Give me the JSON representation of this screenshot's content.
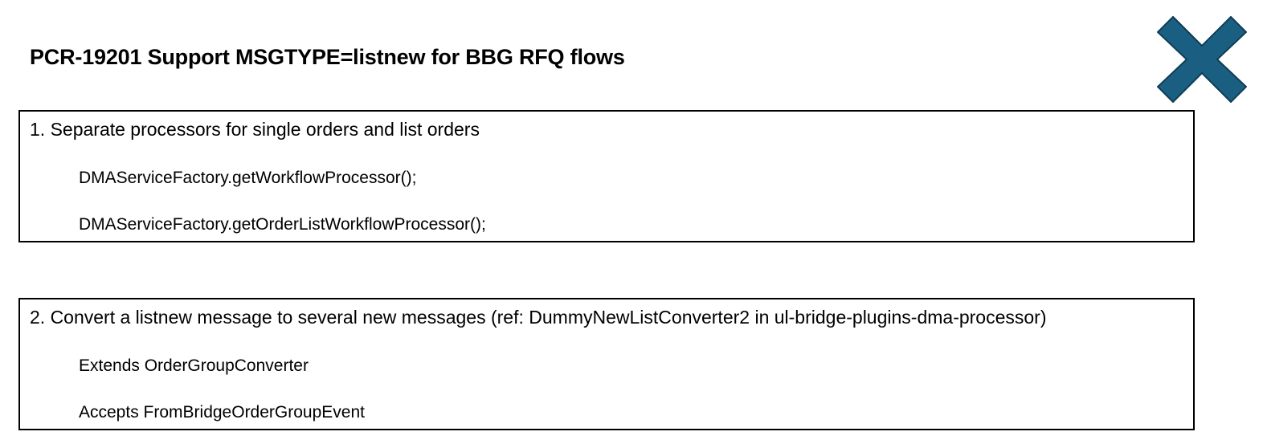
{
  "title": "PCR-19201 Support MSGTYPE=listnew for BBG RFQ flows",
  "close_icon": {
    "name": "close-x-icon",
    "fill": "#1a5f82",
    "stroke": "#0f3d55"
  },
  "sections": [
    {
      "heading": "1. Separate processors for single orders and list orders",
      "lines": [
        "DMAServiceFactory.getWorkflowProcessor();",
        "DMAServiceFactory.getOrderListWorkflowProcessor();"
      ]
    },
    {
      "heading": "2. Convert a listnew message to several new messages (ref: DummyNewListConverter2 in ul-bridge-plugins-dma-processor)",
      "lines": [
        "Extends OrderGroupConverter",
        "Accepts FromBridgeOrderGroupEvent"
      ]
    }
  ]
}
